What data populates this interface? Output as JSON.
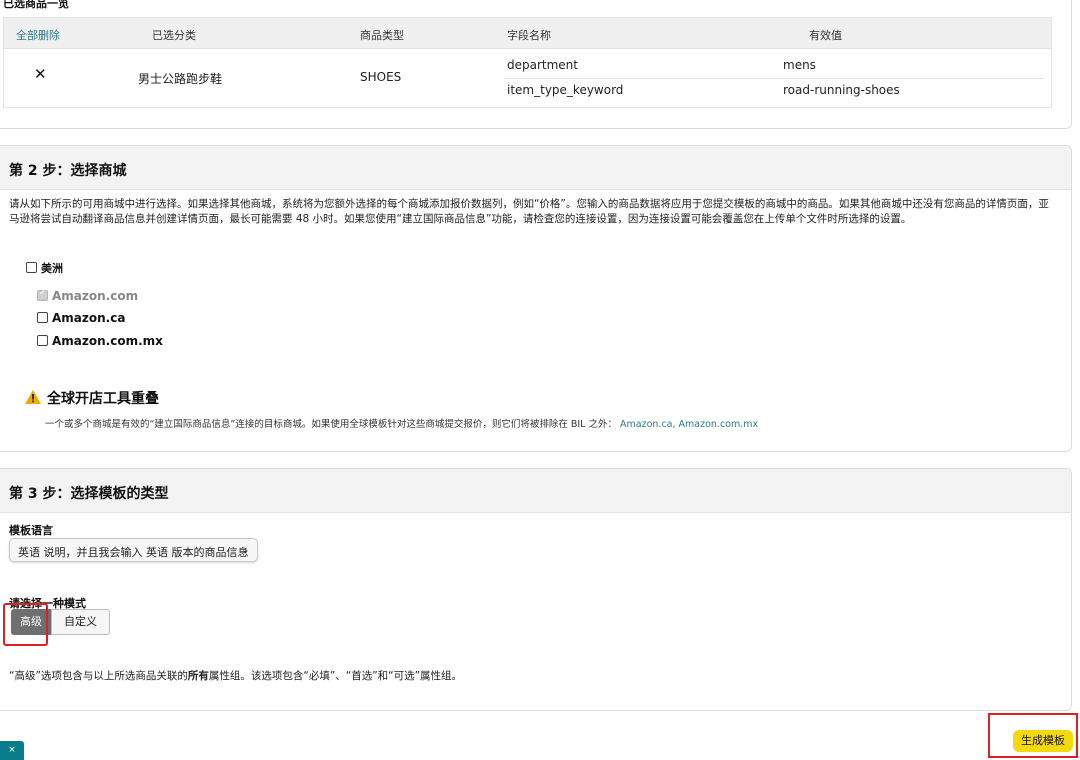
{
  "selected": {
    "title": "已选商品一览",
    "headers": {
      "delete_all": "全部删除",
      "category": "已选分类",
      "product_type": "商品类型",
      "field_name": "字段名称",
      "valid_value": "有效值"
    },
    "row": {
      "delete_icon": "✕",
      "category": "男士公路跑步鞋",
      "product_type": "SHOES",
      "fields": [
        {
          "name": "department",
          "value": "mens"
        },
        {
          "name": "item_type_keyword",
          "value": "road-running-shoes"
        }
      ]
    }
  },
  "step2": {
    "title": "第 2 步：选择商城",
    "description": "请从如下所示的可用商城中进行选择。如果选择其他商城，系统将为您额外选择的每个商城添加报价数据列，例如“价格”。您输入的商品数据将应用于您提交模板的商城中的商品。如果其他商城中还没有您商品的详情页面，亚马逊将尝试自动翻译商品信息并创建详情页面，最长可能需要 48 小时。如果您使用“建立国际商品信息”功能，请检查您的连接设置，因为连接设置可能会覆盖您在上传单个文件时所选择的设置。",
    "region": "美洲",
    "marketplaces": [
      {
        "label": "Amazon.com",
        "checked": true,
        "disabled": true
      },
      {
        "label": "Amazon.ca",
        "checked": false,
        "disabled": false
      },
      {
        "label": "Amazon.com.mx",
        "checked": false,
        "disabled": false
      }
    ],
    "warning": {
      "title": "全球开店工具重叠",
      "body": "一个或多个商城是有效的“建立国际商品信息”连接的目标商城。如果使用全球模板针对这些商城提交报价，则它们将被排除在 BIL 之外：",
      "links": "Amazon.ca, Amazon.com.mx"
    }
  },
  "step3": {
    "title": "第 3 步：选择模板的类型",
    "language_label": "模板语言",
    "language_value": "英语 说明，并且我会输入 英语 版本的商品信息",
    "mode_label": "请选择一种模式",
    "modes": {
      "advanced": "高级",
      "custom": "自定义"
    },
    "note_prefix": "“高级”选项包含与以上所选商品关联的",
    "note_bold": "所有",
    "note_suffix": "属性组。该选项包含“必填”、“首选”和“可选”属性组。"
  },
  "footer": {
    "generate": "生成模板",
    "close": "×"
  },
  "colors": {
    "accent_link": "#2b7a8c",
    "primary_button": "#f5d90f",
    "highlight_box": "#e02020",
    "selected_mode": "#6f6f6f"
  },
  "icons": {
    "delete": "close-icon",
    "warning": "warning-triangle-icon",
    "select": "chevron-down-icon"
  }
}
